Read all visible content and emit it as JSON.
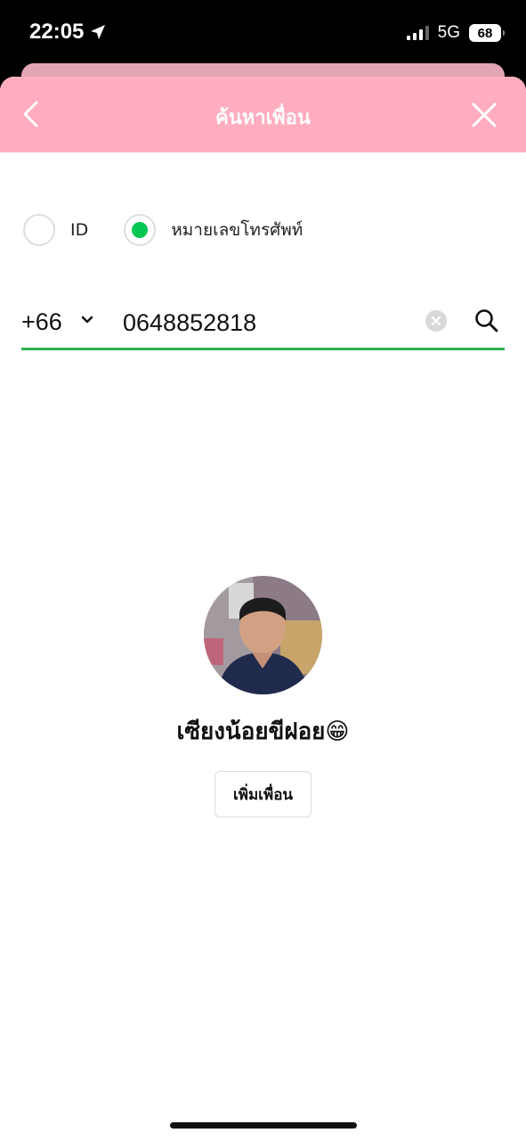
{
  "status_bar": {
    "time": "22:05",
    "network": "5G",
    "battery": "68",
    "icons": [
      "location-arrow-icon",
      "signal-icon",
      "battery-icon"
    ]
  },
  "header": {
    "title": "ค้นหาเพื่อน",
    "background_color": "#ffadbf",
    "icons": [
      "back-chevron-icon",
      "close-icon"
    ]
  },
  "search_type": {
    "options": [
      {
        "label": "ID",
        "selected": false
      },
      {
        "label": "หมายเลขโทรศัพท์",
        "selected": true
      }
    ],
    "accent_color": "#06c755"
  },
  "search": {
    "country_code": "+66",
    "phone_value": "0648852818",
    "underline_color": "#2bb24c",
    "icons": [
      "chevron-down-icon",
      "clear-icon",
      "search-icon"
    ]
  },
  "result": {
    "name": "เซียงน้อยขีฝอย😁",
    "add_friend_label": "เพิ่มเพื่อน"
  }
}
